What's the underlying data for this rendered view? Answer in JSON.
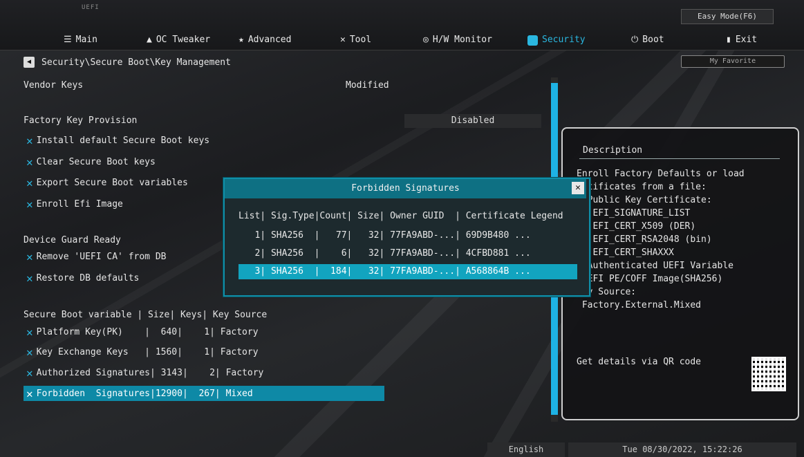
{
  "brand": "UEFI",
  "easy_mode": "Easy Mode(F6)",
  "nav": [
    {
      "label": "Main",
      "icon": "list-icon"
    },
    {
      "label": "OC Tweaker",
      "icon": "rocket-icon"
    },
    {
      "label": "Advanced",
      "icon": "star-icon"
    },
    {
      "label": "Tool",
      "icon": "wrench-icon"
    },
    {
      "label": "H/W Monitor",
      "icon": "monitor-icon"
    },
    {
      "label": "Security",
      "icon": "shield-icon"
    },
    {
      "label": "Boot",
      "icon": "power-icon"
    },
    {
      "label": "Exit",
      "icon": "exit-icon"
    }
  ],
  "breadcrumb": "Security\\Secure Boot\\Key Management",
  "favorite": "My Favorite",
  "vendor_keys": {
    "label": "Vendor Keys",
    "value": "Modified"
  },
  "factory_key": {
    "label": "Factory Key Provision",
    "value": "Disabled"
  },
  "actions": [
    "Install default Secure Boot keys",
    "Clear Secure Boot keys",
    "Export Secure Boot variables",
    "Enroll Efi Image"
  ],
  "device_guard": "Device Guard Ready",
  "device_actions": [
    "Remove 'UEFI CA' from DB",
    "Restore DB defaults"
  ],
  "var_header": "Secure Boot variable | Size| Keys| Key Source",
  "variables": [
    {
      "name": "Platform Key(PK)    ",
      "size": "640",
      "keys": "1",
      "source": "Factory"
    },
    {
      "name": "Key Exchange Keys   ",
      "size": "1560",
      "keys": "1",
      "source": "Factory"
    },
    {
      "name": "Authorized Signatures",
      "size": "3143",
      "keys": "2",
      "source": "Factory"
    },
    {
      "name": "Forbidden  Signatures",
      "size": "12900",
      "keys": "267",
      "source": "Mixed"
    }
  ],
  "variable_rows": [
    "Platform Key(PK)    |  640|    1| Factory",
    "Key Exchange Keys   | 1560|    1| Factory",
    "Authorized Signatures| 3143|    2| Factory",
    "Forbidden  Signatures|12900|  267| Mixed"
  ],
  "popup": {
    "title": "Forbidden  Signatures",
    "header": "List| Sig.Type|Count| Size| Owner GUID  | Certificate Legend",
    "rows": [
      "   1| SHA256  |   77|   32| 77FA9ABD-...| 69D9B480 ...",
      "   2| SHA256  |    6|   32| 77FA9ABD-...| 4CFBD881 ...",
      "   3| SHA256  |  184|   32| 77FA9ABD-...| A568864B ..."
    ],
    "selected_index": 2
  },
  "description": {
    "title": "Description",
    "text": "Enroll Factory Defaults or load\n  tificates from a file:\n  Public Key Certificate:\n  )EFI_SIGNATURE_LIST\n  )EFI_CERT_X509 (DER)\n  )EFI_CERT_RSA2048 (bin)\n  )EFI_CERT_SHAXXX\n  Authenticated UEFI Variable\n  EFI PE/COFF Image(SHA256)\nKey Source:\n Factory.External.Mixed",
    "qr_label": "Get details via QR code"
  },
  "status": {
    "language": "English",
    "datetime": "Tue 08/30/2022, 15:22:26"
  },
  "colors": {
    "accent": "#2ab7e0",
    "highlight": "#0e89a6",
    "popup_header": "#0e7083"
  }
}
